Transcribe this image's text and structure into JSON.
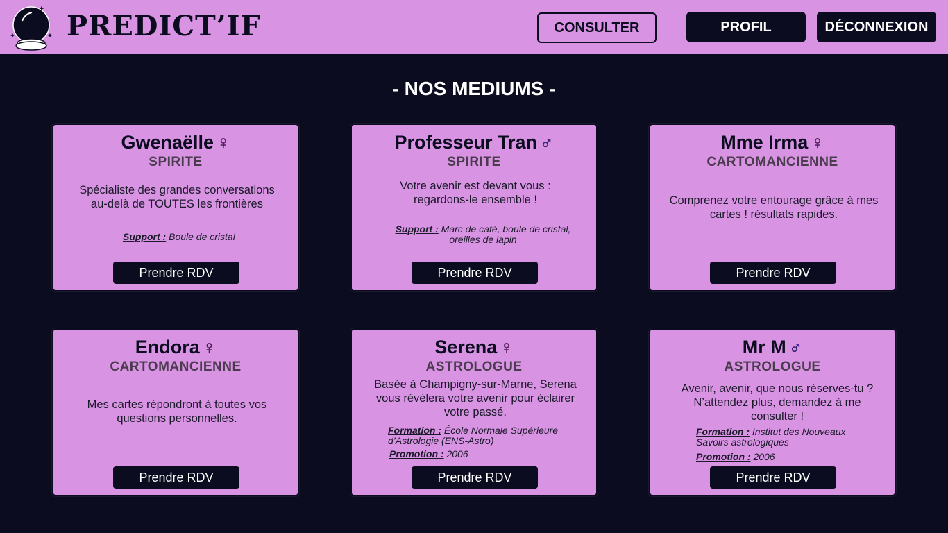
{
  "header": {
    "logo_text": "PREDICT’IF",
    "nav": {
      "consulter": "CONSULTER",
      "profil": "PROFIL",
      "deconnexion": "DÉCONNEXION"
    }
  },
  "section_title": "- NOS MEDIUMS -",
  "cards": [
    {
      "name": "Gwenaëlle",
      "gender_symbol": "♀",
      "specialty": "SPIRITE",
      "description": "Spécialiste des grandes conversations au-delà de TOUTES les frontières",
      "support_label": "Support :",
      "support_value": "Boule de cristal",
      "button": "Prendre RDV"
    },
    {
      "name": "Professeur Tran",
      "gender_symbol": "♂",
      "specialty": "SPIRITE",
      "description": "Votre avenir est devant vous : regardons-le ensemble !",
      "support_label": "Support :",
      "support_value": "Marc de café, boule de cristal, oreilles de lapin",
      "button": "Prendre RDV"
    },
    {
      "name": "Mme Irma",
      "gender_symbol": "♀",
      "specialty": "CARTOMANCIENNE",
      "description": "Comprenez votre entourage grâce à mes cartes ! résultats rapides.",
      "button": "Prendre RDV"
    },
    {
      "name": "Endora",
      "gender_symbol": "♀",
      "specialty": "CARTOMANCIENNE",
      "description": "Mes cartes répondront à toutes vos questions personnelles.",
      "button": "Prendre RDV"
    },
    {
      "name": "Serena",
      "gender_symbol": "♀",
      "specialty": "ASTROLOGUE",
      "description": "Basée à Champigny-sur-Marne, Serena vous révèlera votre avenir pour éclairer votre passé.",
      "formation_label": "Formation :",
      "formation_value": "École Normale Supérieure d’Astrologie (ENS-Astro)",
      "promotion_label": "Promotion :",
      "promotion_value": "2006",
      "button": "Prendre RDV"
    },
    {
      "name": "Mr M",
      "gender_symbol": "♂",
      "specialty": "ASTROLOGUE",
      "description": "Avenir, avenir, que nous réserves-tu ? N’attendez plus, demandez à me consulter !",
      "formation_label": "Formation :",
      "formation_value": "Institut des Nouveaux Savoirs astrologiques",
      "promotion_label": "Promotion :",
      "promotion_value": "2006",
      "button": "Prendre RDV"
    }
  ]
}
